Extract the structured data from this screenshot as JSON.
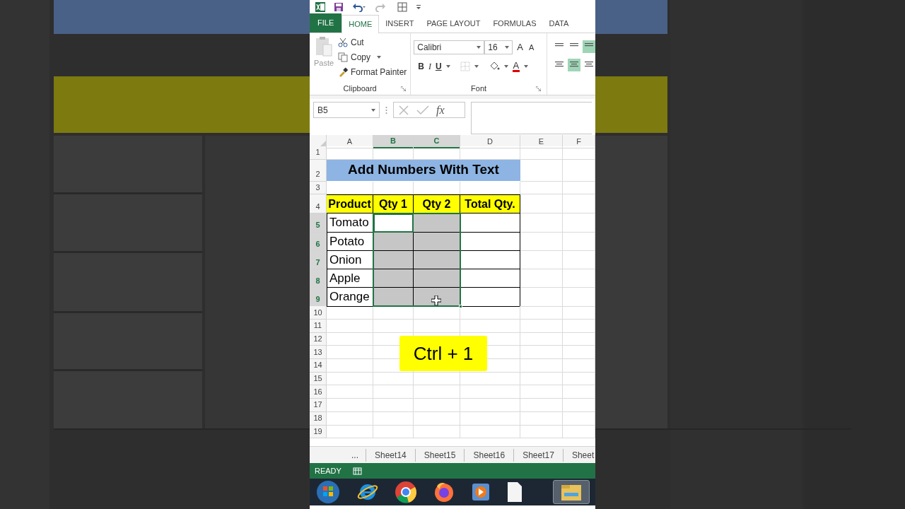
{
  "ribbon_tabs": [
    {
      "label": "FILE",
      "kind": "file",
      "selected": false
    },
    {
      "label": "HOME",
      "kind": "tab",
      "selected": true
    },
    {
      "label": "INSERT",
      "kind": "tab",
      "selected": false
    },
    {
      "label": "PAGE LAYOUT",
      "kind": "tab",
      "selected": false
    },
    {
      "label": "FORMULAS",
      "kind": "tab",
      "selected": false
    },
    {
      "label": "DATA",
      "kind": "tab",
      "selected": false
    }
  ],
  "clipboard": {
    "paste": "Paste",
    "cut": "Cut",
    "copy": "Copy",
    "format_painter": "Format Painter",
    "group": "Clipboard"
  },
  "font": {
    "name": "Calibri",
    "size": "16",
    "grow": "A",
    "shrink": "A",
    "bold": "B",
    "italic": "I",
    "underline": "U",
    "font_color": "A",
    "group": "Font"
  },
  "name_box": "B5",
  "fx": "fx",
  "columns": [
    {
      "label": "A",
      "selected": false
    },
    {
      "label": "B",
      "selected": true
    },
    {
      "label": "C",
      "selected": true
    },
    {
      "label": "D",
      "selected": false
    },
    {
      "label": "E",
      "selected": false
    },
    {
      "label": "F",
      "selected": false
    }
  ],
  "rows": [
    {
      "label": "1",
      "kind": "empty",
      "selected": false
    },
    {
      "label": "2",
      "kind": "title",
      "selected": false,
      "text": "Add Numbers With Text"
    },
    {
      "label": "3",
      "kind": "empty",
      "selected": false
    },
    {
      "label": "4",
      "kind": "header",
      "selected": false,
      "cells": [
        {
          "text": "Product"
        },
        {
          "text": "Qty 1"
        },
        {
          "text": "Qty 2"
        },
        {
          "text": "Total Qty."
        }
      ]
    },
    {
      "label": "5",
      "kind": "data",
      "selected": true,
      "cells": [
        {
          "text": "Tomato",
          "selected": false,
          "active": false
        },
        {
          "selected": true,
          "active": true
        },
        {
          "selected": true,
          "active": false
        },
        {
          "selected": false,
          "active": false
        }
      ]
    },
    {
      "label": "6",
      "kind": "data",
      "selected": true,
      "cells": [
        {
          "text": "Potato",
          "selected": false,
          "active": false
        },
        {
          "selected": true,
          "active": false
        },
        {
          "selected": true,
          "active": false
        },
        {
          "selected": false,
          "active": false
        }
      ]
    },
    {
      "label": "7",
      "kind": "data",
      "selected": true,
      "cells": [
        {
          "text": "Onion",
          "selected": false,
          "active": false
        },
        {
          "selected": true,
          "active": false
        },
        {
          "selected": true,
          "active": false
        },
        {
          "selected": false,
          "active": false
        }
      ]
    },
    {
      "label": "8",
      "kind": "data",
      "selected": true,
      "cells": [
        {
          "text": "Apple",
          "selected": false,
          "active": false
        },
        {
          "selected": true,
          "active": false
        },
        {
          "selected": true,
          "active": false
        },
        {
          "selected": false,
          "active": false
        }
      ]
    },
    {
      "label": "9",
      "kind": "data",
      "selected": true,
      "cells": [
        {
          "text": "Orange",
          "selected": false,
          "active": false
        },
        {
          "selected": true,
          "active": false
        },
        {
          "selected": true,
          "active": false
        },
        {
          "selected": false,
          "active": false
        }
      ]
    },
    {
      "label": "10",
      "kind": "empty",
      "selected": false
    },
    {
      "label": "11",
      "kind": "empty",
      "selected": false
    },
    {
      "label": "12",
      "kind": "empty",
      "selected": false
    },
    {
      "label": "13",
      "kind": "empty",
      "selected": false
    },
    {
      "label": "14",
      "kind": "empty",
      "selected": false
    },
    {
      "label": "15",
      "kind": "empty",
      "selected": false
    },
    {
      "label": "16",
      "kind": "empty",
      "selected": false
    },
    {
      "label": "17",
      "kind": "empty",
      "selected": false
    },
    {
      "label": "18",
      "kind": "empty",
      "selected": false
    },
    {
      "label": "19",
      "kind": "empty",
      "selected": false
    }
  ],
  "shortcut_caption": "Ctrl + 1",
  "sheet_tabs": [
    "...",
    "Sheet14",
    "Sheet15",
    "Sheet16",
    "Sheet17",
    "Sheet"
  ],
  "status": "READY"
}
